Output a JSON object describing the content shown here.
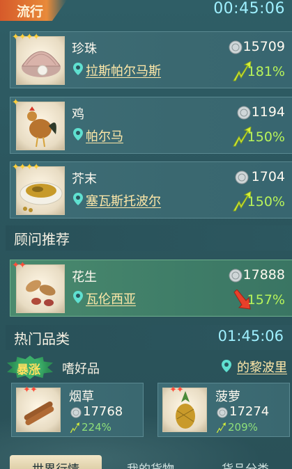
{
  "header": {
    "tag": "流行",
    "timer": "00:45:06"
  },
  "trending": [
    {
      "stars": "✦✦✦✦",
      "star_color": "gold",
      "name": "珍珠",
      "location": "拉斯帕尔马斯",
      "price": "15709",
      "change": "181%",
      "direction": "up",
      "item_icon": "pearl-oyster-icon"
    },
    {
      "stars": "✦",
      "star_color": "gold",
      "name": "鸡",
      "location": "帕尔马",
      "price": "1194",
      "change": "150%",
      "direction": "up",
      "item_icon": "rooster-icon"
    },
    {
      "stars": "✦✦✦✦",
      "star_color": "gold",
      "name": "芥末",
      "location": "塞瓦斯托波尔",
      "price": "1704",
      "change": "150%",
      "direction": "up",
      "item_icon": "mustard-plate-icon"
    }
  ],
  "advisor": {
    "title": "顾问推荐",
    "item": {
      "stars": "✦✦",
      "star_color": "red",
      "name": "花生",
      "location": "瓦伦西亚",
      "price": "17888",
      "change": "157%",
      "direction": "down",
      "item_icon": "peanuts-icon"
    }
  },
  "hot_category": {
    "title": "热门品类",
    "timer": "01:45:06",
    "badge": "暴涨",
    "category": "嗜好品",
    "city": "的黎波里",
    "items": [
      {
        "stars": "✦✦",
        "name": "烟草",
        "price": "17768",
        "change": "224%",
        "item_icon": "tobacco-rolls-icon"
      },
      {
        "stars": "✦✦",
        "name": "菠萝",
        "price": "17274",
        "change": "209%",
        "item_icon": "pineapple-icon"
      }
    ]
  },
  "tabs": [
    "世界行情",
    "我的货物",
    "货品分类"
  ],
  "colors": {
    "accent_cyan": "#9ff0ff",
    "location_gold": "#ffe8a8",
    "up_green": "#b8f45a",
    "down_red": "#e8402a"
  }
}
